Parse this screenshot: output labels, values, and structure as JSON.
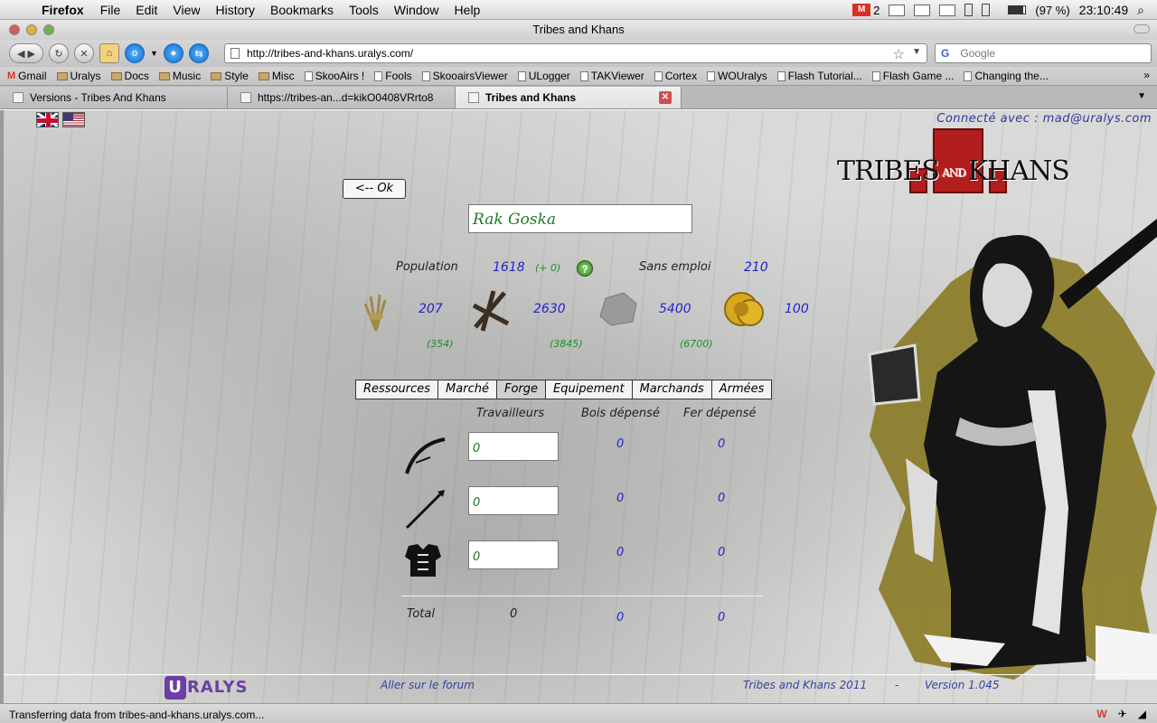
{
  "menubar": {
    "app": "Firefox",
    "items": [
      "File",
      "Edit",
      "View",
      "History",
      "Bookmarks",
      "Tools",
      "Window",
      "Help"
    ],
    "mail_count": "2",
    "battery": "(97 %)",
    "clock": "23:10:49"
  },
  "window": {
    "title": "Tribes and Khans"
  },
  "nav": {
    "url": "http://tribes-and-khans.uralys.com/",
    "search_placeholder": "Google"
  },
  "bookmarks": [
    {
      "label": "Gmail",
      "type": "gmail"
    },
    {
      "label": "Uralys",
      "type": "folder"
    },
    {
      "label": "Docs",
      "type": "folder"
    },
    {
      "label": "Music",
      "type": "folder"
    },
    {
      "label": "Style",
      "type": "folder"
    },
    {
      "label": "Misc",
      "type": "folder"
    },
    {
      "label": "SkooAirs !",
      "type": "page"
    },
    {
      "label": "Fools",
      "type": "page"
    },
    {
      "label": "SkooairsViewer",
      "type": "page"
    },
    {
      "label": "ULogger",
      "type": "page"
    },
    {
      "label": "TAKViewer",
      "type": "page"
    },
    {
      "label": "Cortex",
      "type": "page"
    },
    {
      "label": "WOUralys",
      "type": "page"
    },
    {
      "label": "Flash Tutorial...",
      "type": "page"
    },
    {
      "label": "Flash Game ...",
      "type": "page"
    },
    {
      "label": "Changing the...",
      "type": "page"
    }
  ],
  "tabs": [
    {
      "label": "Versions - Tribes And Khans",
      "active": false
    },
    {
      "label": "https://tribes-an...d=kikO0408VRrto8",
      "active": false
    },
    {
      "label": "Tribes and Khans",
      "active": true
    }
  ],
  "game": {
    "connected": "Connecté avec : mad@uralys.com",
    "logo_left": "TRIBES",
    "logo_and": "AND",
    "logo_right": "KHANS",
    "ok_button": "<-- Ok",
    "city_name": "Rak Goska",
    "population_label": "Population",
    "population_value": "1618",
    "population_delta": "(+ 0)",
    "unemployed_label": "Sans emploi",
    "unemployed_value": "210",
    "resources": [
      {
        "icon": "wheat-icon",
        "value": "207",
        "capacity": "(354)"
      },
      {
        "icon": "wood-icon",
        "value": "2630",
        "capacity": "(3845)"
      },
      {
        "icon": "stone-icon",
        "value": "5400",
        "capacity": "(6700)"
      },
      {
        "icon": "gold-icon",
        "value": "100",
        "capacity": ""
      }
    ],
    "tabs": [
      "Ressources",
      "Marché",
      "Forge",
      "Equipement",
      "Marchands",
      "Armées"
    ],
    "active_tab": "Forge",
    "columns": {
      "workers": "Travailleurs",
      "wood": "Bois dépensé",
      "iron": "Fer dépensé"
    },
    "rows": [
      {
        "icon": "bow-icon",
        "workers": "0",
        "wood": "0",
        "iron": "0"
      },
      {
        "icon": "spear-icon",
        "workers": "0",
        "wood": "0",
        "iron": "0"
      },
      {
        "icon": "armor-icon",
        "workers": "0",
        "wood": "0",
        "iron": "0"
      }
    ],
    "total_label": "Total",
    "total_workers": "0",
    "total_wood": "0",
    "total_iron": "0",
    "footer": {
      "brand": "RALYS",
      "brand_u": "U",
      "forum": "Aller sur le forum",
      "copyright": "Tribes and Khans 2011",
      "separator": "-",
      "version": "Version 1.045"
    }
  },
  "status": {
    "text": "Transferring data from tribes-and-khans.uralys.com..."
  }
}
